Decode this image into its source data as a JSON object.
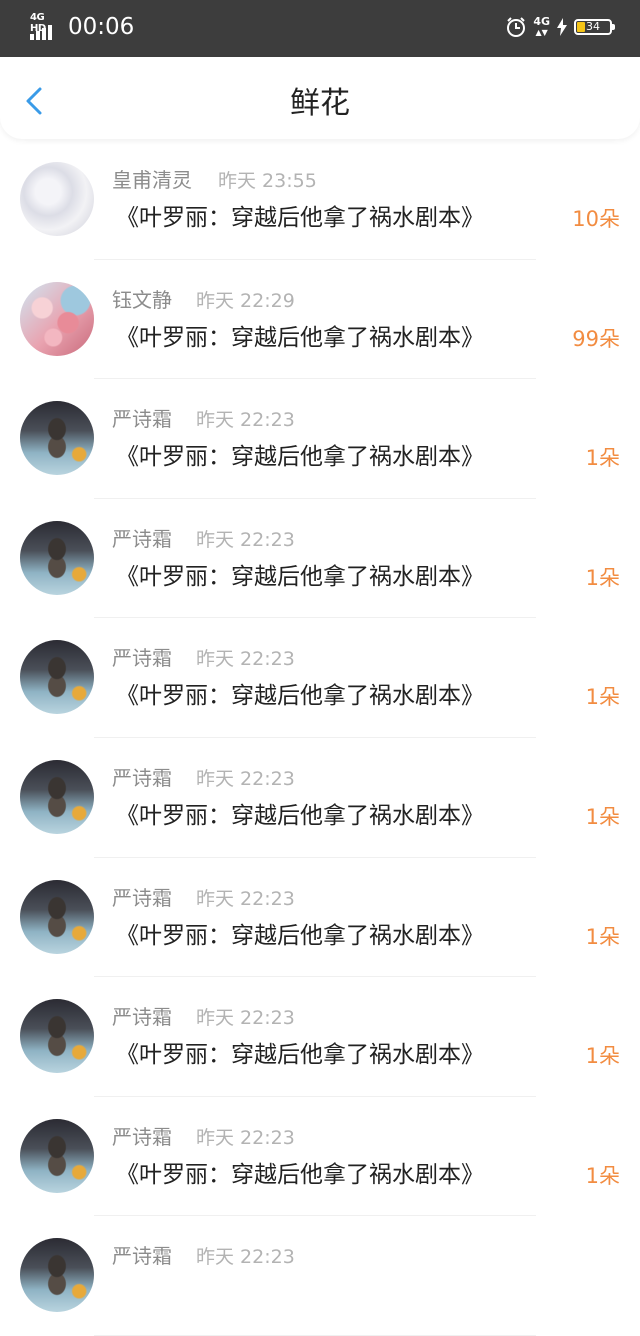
{
  "status_bar": {
    "network_left": "4G HD",
    "time": "00:06",
    "network_right": "4G",
    "battery": "34"
  },
  "header": {
    "title": "鲜花"
  },
  "colors": {
    "accent_count": "#f28c41",
    "back_arrow": "#3a9be8",
    "status_bar_bg": "#3d3d3d"
  },
  "items": [
    {
      "avatar": "anime-girl-avatar",
      "sender": "皇甫清灵",
      "time": "昨天 23:55",
      "book": "《叶罗丽：穿越后他拿了祸水剧本》",
      "count": "10朵"
    },
    {
      "avatar": "flower-avatar",
      "sender": "钰文静",
      "time": "昨天 22:29",
      "book": "《叶罗丽：穿越后他拿了祸水剧本》",
      "count": "99朵"
    },
    {
      "avatar": "cat-avatar",
      "sender": "严诗霜",
      "time": "昨天 22:23",
      "book": "《叶罗丽：穿越后他拿了祸水剧本》",
      "count": "1朵"
    },
    {
      "avatar": "cat-avatar",
      "sender": "严诗霜",
      "time": "昨天 22:23",
      "book": "《叶罗丽：穿越后他拿了祸水剧本》",
      "count": "1朵"
    },
    {
      "avatar": "cat-avatar",
      "sender": "严诗霜",
      "time": "昨天 22:23",
      "book": "《叶罗丽：穿越后他拿了祸水剧本》",
      "count": "1朵"
    },
    {
      "avatar": "cat-avatar",
      "sender": "严诗霜",
      "time": "昨天 22:23",
      "book": "《叶罗丽：穿越后他拿了祸水剧本》",
      "count": "1朵"
    },
    {
      "avatar": "cat-avatar",
      "sender": "严诗霜",
      "time": "昨天 22:23",
      "book": "《叶罗丽：穿越后他拿了祸水剧本》",
      "count": "1朵"
    },
    {
      "avatar": "cat-avatar",
      "sender": "严诗霜",
      "time": "昨天 22:23",
      "book": "《叶罗丽：穿越后他拿了祸水剧本》",
      "count": "1朵"
    },
    {
      "avatar": "cat-avatar",
      "sender": "严诗霜",
      "time": "昨天 22:23",
      "book": "《叶罗丽：穿越后他拿了祸水剧本》",
      "count": "1朵"
    },
    {
      "avatar": "cat-avatar",
      "sender": "严诗霜",
      "time": "昨天 22:23",
      "book": "",
      "count": ""
    }
  ]
}
